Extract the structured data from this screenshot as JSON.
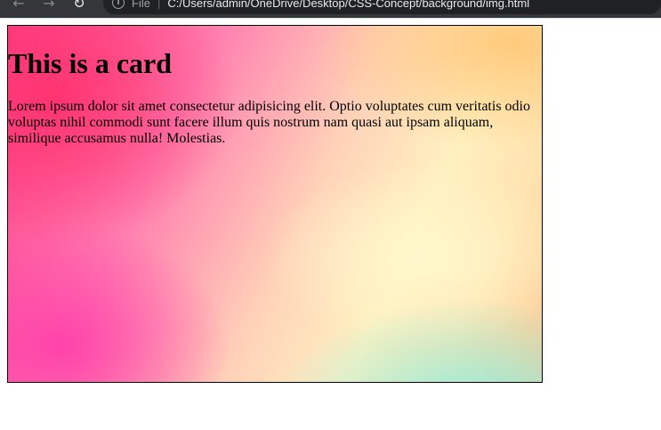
{
  "browser": {
    "back_icon": "←",
    "forward_icon": "→",
    "reload_icon": "↻",
    "scheme": "File",
    "url": "C:/Users/admin/OneDrive/Desktop/CSS-Concept/background/img.html"
  },
  "card": {
    "title": "This is a card",
    "text": "Lorem ipsum dolor sit amet consectetur adipisicing elit. Optio voluptates cum veritatis odio voluptas nihil commodi sunt facere illum quis nostrum nam quasi aut ipsam aliquam, similique accusamus nulla! Molestias."
  }
}
